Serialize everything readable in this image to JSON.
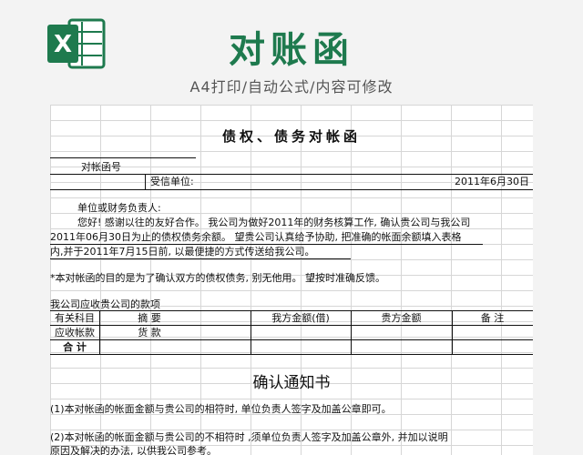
{
  "banner": {
    "title": "对账函",
    "subtitle": "A4打印/自动公式/内容可修改",
    "logo_letter": "X",
    "accent_color": "#1e7a4e"
  },
  "document": {
    "heading": "债权、债务对帐函",
    "ref_label": "对帐函号",
    "recipient_label": "受信单位:",
    "date": "2011年6月30日",
    "salutation": "单位或财务负责人:",
    "para_line1": "您好! 感谢以往的友好合作。 我公司为做好2011年的财务核算工作, 确认贵公司与我公司",
    "para_line2": "2011年06月30日为止的债权债务余额。    望贵公司认真给予协助, 把准确的帐面余额填入表格",
    "para_line3": "内,并于2011年7月15日前, 以最便捷的方式传送给我公司。",
    "note": "*本对帐函的目的是为了确认双方的债权债务,    别无他用。    望按时准确反馈。",
    "receivable_caption": "我公司应收贵公司的款项",
    "table": {
      "headers": [
        "有关科目",
        "摘      要",
        "我方金额(借)",
        "贵方金额",
        "备      注"
      ],
      "row1": [
        "应收帐款",
        "货      款",
        "",
        "",
        ""
      ],
      "total_label": "合      计"
    },
    "confirm_title": "确认通知书",
    "confirm_item1": "(1)本对帐函的帐面金额与贵公司的相符时, 单位负责人签字及加盖公章即可。",
    "confirm_item2_line1": "(2)本对帐函的帐面金额与贵公司的不相符时 ,须单位负责人签字及加盖公章外, 并加以说明",
    "confirm_item2_line2": "原因及解决的办法, 以供我公司参考。"
  }
}
